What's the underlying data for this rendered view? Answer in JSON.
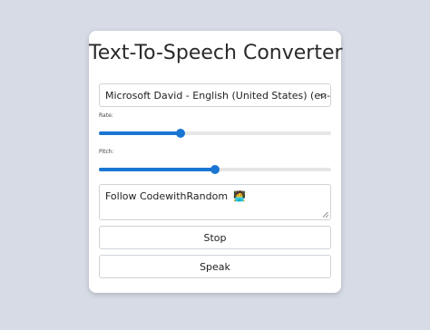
{
  "title": "Text-To-Speech Converter",
  "voice_select": {
    "selected": "Microsoft David - English (United States) (en-US)"
  },
  "rate": {
    "label": "Rate:",
    "value": 0.35
  },
  "pitch": {
    "label": "Pitch:",
    "value": 0.5
  },
  "text_input": {
    "value": "Follow CodewithRandom",
    "emoji": "🧑‍💻"
  },
  "buttons": {
    "stop_label": "Stop",
    "speak_label": "Speak"
  },
  "colors": {
    "accent": "#1976d2",
    "background": "#d6dbe5"
  }
}
